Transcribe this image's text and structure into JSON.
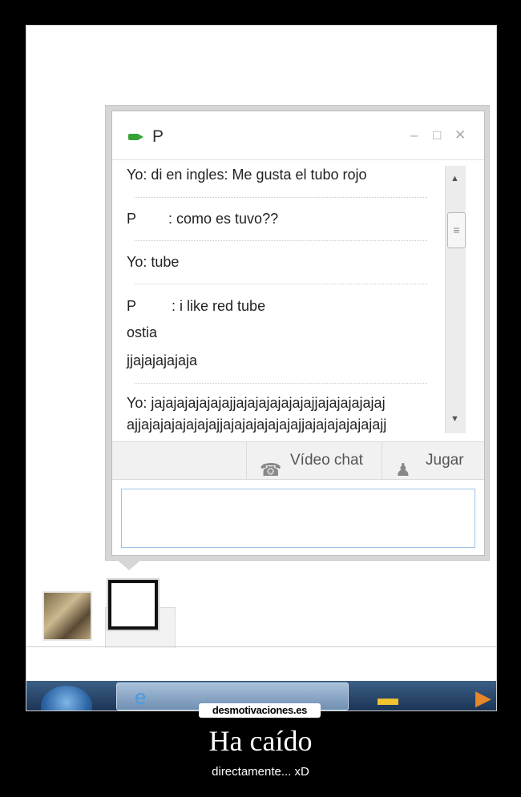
{
  "chat": {
    "contact_name": "P",
    "controls": {
      "minimize": "–",
      "maximize": "□",
      "close": "✕"
    },
    "messages": [
      {
        "speaker": "Yo",
        "text": ": di en ingles: Me gusta el tubo rojo"
      },
      {
        "speaker": "P",
        "text": ": como es tuvo??"
      },
      {
        "speaker": "Yo",
        "text": ": tube"
      },
      {
        "speaker": "P",
        "text": ": i like red tube"
      },
      {
        "speaker": "",
        "text": "ostia"
      },
      {
        "speaker": "",
        "text": "jjajajajajaja"
      },
      {
        "speaker": "Yo",
        "text": ": jajajajajajajajjajajajajajajajjajajajajajaj"
      },
      {
        "speaker": "",
        "text": "ajjajajajajajajajjajajajajajajajjajajajajajajajj"
      }
    ],
    "actions": {
      "video_chat": "Vídeo chat",
      "play": "Jugar"
    },
    "input_value": ""
  },
  "poster": {
    "brand": "desmotivaciones.es",
    "title": "Ha caído",
    "subtitle": "directamente... xD"
  },
  "icons": [
    "video-camera-icon",
    "minimize-icon",
    "maximize-icon",
    "close-icon",
    "scroll-up-icon",
    "scroll-down-icon",
    "video-chat-icon",
    "game-icon",
    "windows-start-icon",
    "ie-icon",
    "folder-icon"
  ]
}
